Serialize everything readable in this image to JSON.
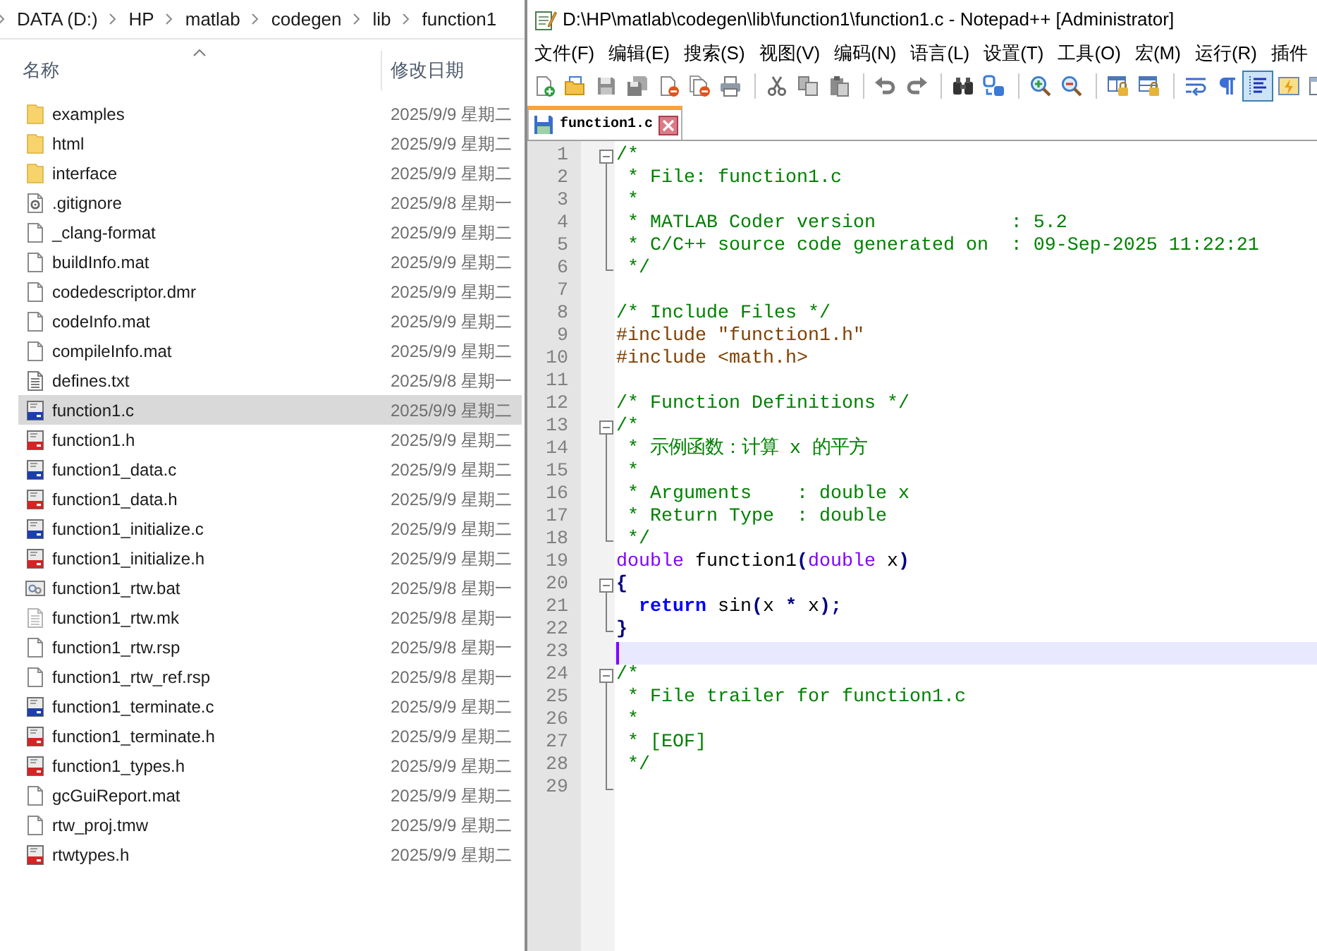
{
  "explorer": {
    "breadcrumb": [
      "DATA (D:)",
      "HP",
      "matlab",
      "codegen",
      "lib",
      "function1"
    ],
    "columns": [
      {
        "label": "名称",
        "sorted": true
      },
      {
        "label": "修改日期",
        "sorted": false
      }
    ],
    "rows": [
      {
        "kind": "folder",
        "name": "examples",
        "date": "2025/9/9 星期二",
        "selected": false
      },
      {
        "kind": "folder",
        "name": "html",
        "date": "2025/9/9 星期二",
        "selected": false
      },
      {
        "kind": "folder",
        "name": "interface",
        "date": "2025/9/9 星期二",
        "selected": false
      },
      {
        "kind": "config",
        "name": ".gitignore",
        "date": "2025/9/8 星期一",
        "selected": false
      },
      {
        "kind": "blank",
        "name": "_clang-format",
        "date": "2025/9/9 星期二",
        "selected": false
      },
      {
        "kind": "blank",
        "name": "buildInfo.mat",
        "date": "2025/9/9 星期二",
        "selected": false
      },
      {
        "kind": "blank",
        "name": "codedescriptor.dmr",
        "date": "2025/9/9 星期二",
        "selected": false
      },
      {
        "kind": "blank",
        "name": "codeInfo.mat",
        "date": "2025/9/9 星期二",
        "selected": false
      },
      {
        "kind": "blank",
        "name": "compileInfo.mat",
        "date": "2025/9/9 星期二",
        "selected": false
      },
      {
        "kind": "text",
        "name": "defines.txt",
        "date": "2025/9/8 星期一",
        "selected": false
      },
      {
        "kind": "source",
        "name": "function1.c",
        "date": "2025/9/9 星期二",
        "selected": true
      },
      {
        "kind": "header",
        "name": "function1.h",
        "date": "2025/9/9 星期二",
        "selected": false
      },
      {
        "kind": "source",
        "name": "function1_data.c",
        "date": "2025/9/9 星期二",
        "selected": false
      },
      {
        "kind": "header",
        "name": "function1_data.h",
        "date": "2025/9/9 星期二",
        "selected": false
      },
      {
        "kind": "source",
        "name": "function1_initialize.c",
        "date": "2025/9/9 星期二",
        "selected": false
      },
      {
        "kind": "header",
        "name": "function1_initialize.h",
        "date": "2025/9/9 星期二",
        "selected": false
      },
      {
        "kind": "batch",
        "name": "function1_rtw.bat",
        "date": "2025/9/8 星期一",
        "selected": false
      },
      {
        "kind": "makefile",
        "name": "function1_rtw.mk",
        "date": "2025/9/8 星期一",
        "selected": false
      },
      {
        "kind": "blank",
        "name": "function1_rtw.rsp",
        "date": "2025/9/8 星期一",
        "selected": false
      },
      {
        "kind": "blank",
        "name": "function1_rtw_ref.rsp",
        "date": "2025/9/8 星期一",
        "selected": false
      },
      {
        "kind": "source",
        "name": "function1_terminate.c",
        "date": "2025/9/9 星期二",
        "selected": false
      },
      {
        "kind": "header",
        "name": "function1_terminate.h",
        "date": "2025/9/9 星期二",
        "selected": false
      },
      {
        "kind": "header",
        "name": "function1_types.h",
        "date": "2025/9/9 星期二",
        "selected": false
      },
      {
        "kind": "blank",
        "name": "gcGuiReport.mat",
        "date": "2025/9/9 星期二",
        "selected": false
      },
      {
        "kind": "blank",
        "name": "rtw_proj.tmw",
        "date": "2025/9/9 星期二",
        "selected": false
      },
      {
        "kind": "header",
        "name": "rtwtypes.h",
        "date": "2025/9/9 星期二",
        "selected": false
      }
    ]
  },
  "editor_window": {
    "title": "D:\\HP\\matlab\\codegen\\lib\\function1\\function1.c - Notepad++ [Administrator]",
    "menu": [
      "文件(F)",
      "编辑(E)",
      "搜索(S)",
      "视图(V)",
      "编码(N)",
      "语言(L)",
      "设置(T)",
      "工具(O)",
      "宏(M)",
      "运行(R)",
      "插件"
    ],
    "toolbar": {
      "groups": [
        {
          "buttons": [
            {
              "pressed": false
            },
            {
              "pressed": false
            },
            {
              "pressed": false
            },
            {
              "pressed": false
            },
            {
              "pressed": false
            },
            {
              "pressed": false
            },
            {
              "pressed": false
            }
          ]
        },
        {
          "buttons": [
            {
              "pressed": false
            },
            {
              "pressed": false
            },
            {
              "pressed": false
            }
          ]
        },
        {
          "buttons": [
            {
              "pressed": false
            },
            {
              "pressed": false
            }
          ]
        },
        {
          "buttons": [
            {
              "pressed": false
            },
            {
              "pressed": false
            }
          ]
        },
        {
          "buttons": [
            {
              "pressed": false
            },
            {
              "pressed": false
            }
          ]
        },
        {
          "buttons": [
            {
              "pressed": false
            },
            {
              "pressed": false
            }
          ]
        },
        {
          "buttons": [
            {
              "pressed": false
            },
            {
              "pressed": false
            },
            {
              "pressed": true
            },
            {
              "pressed": false
            },
            {
              "pressed": false
            }
          ]
        }
      ]
    },
    "tabs": [
      {
        "label": "function1.c",
        "selected": true,
        "modified": false
      }
    ],
    "lines": [
      {
        "number": "1",
        "kind": "head",
        "current": false,
        "tokens": [
          {
            "kind": "comment",
            "text": "/*"
          }
        ]
      },
      {
        "number": "2",
        "kind": "body",
        "current": false,
        "tokens": [
          {
            "kind": "comment",
            "text": " * File: function1.c"
          }
        ]
      },
      {
        "number": "3",
        "kind": "body",
        "current": false,
        "tokens": [
          {
            "kind": "comment",
            "text": " *"
          }
        ]
      },
      {
        "number": "4",
        "kind": "body",
        "current": false,
        "tokens": [
          {
            "kind": "comment",
            "text": " * MATLAB Coder version            : 5.2"
          }
        ]
      },
      {
        "number": "5",
        "kind": "body",
        "current": false,
        "tokens": [
          {
            "kind": "comment",
            "text": " * C/C++ source code generated on  : 09-Sep-2025 11:22:21"
          }
        ]
      },
      {
        "number": "6",
        "kind": "tail",
        "current": false,
        "tokens": [
          {
            "kind": "comment",
            "text": " */"
          }
        ]
      },
      {
        "number": "7",
        "kind": "plain",
        "current": false
      },
      {
        "number": "8",
        "kind": "plain",
        "current": false,
        "tokens": [
          {
            "kind": "comment",
            "text": "/* Include Files */"
          }
        ]
      },
      {
        "number": "9",
        "kind": "plain",
        "current": false,
        "tokens": [
          {
            "kind": "preprocessor",
            "text": "#include \"function1.h\""
          }
        ]
      },
      {
        "number": "10",
        "kind": "plain",
        "current": false,
        "tokens": [
          {
            "kind": "preprocessor",
            "text": "#include <math.h>"
          }
        ]
      },
      {
        "number": "11",
        "kind": "plain",
        "current": false
      },
      {
        "number": "12",
        "kind": "plain",
        "current": false,
        "tokens": [
          {
            "kind": "comment",
            "text": "/* Function Definitions */"
          }
        ]
      },
      {
        "number": "13",
        "kind": "head",
        "current": false,
        "tokens": [
          {
            "kind": "comment",
            "text": "/*"
          }
        ]
      },
      {
        "number": "14",
        "kind": "body",
        "current": false,
        "tokens": [
          {
            "kind": "comment",
            "text": " * 示例函数：计算 x 的平方"
          }
        ]
      },
      {
        "number": "15",
        "kind": "body",
        "current": false,
        "tokens": [
          {
            "kind": "comment",
            "text": " *"
          }
        ]
      },
      {
        "number": "16",
        "kind": "body",
        "current": false,
        "tokens": [
          {
            "kind": "comment",
            "text": " * Arguments    : double x"
          }
        ]
      },
      {
        "number": "17",
        "kind": "body",
        "current": false,
        "tokens": [
          {
            "kind": "comment",
            "text": " * Return Type  : double"
          }
        ]
      },
      {
        "number": "18",
        "kind": "tail",
        "current": false,
        "tokens": [
          {
            "kind": "comment",
            "text": " */"
          }
        ]
      },
      {
        "number": "19",
        "kind": "plain",
        "current": false,
        "tokens": [
          {
            "kind": "type",
            "text": "double"
          },
          {
            "kind": "plain",
            "text": " function1"
          },
          {
            "kind": "operator",
            "text": "("
          },
          {
            "kind": "type",
            "text": "double"
          },
          {
            "kind": "plain",
            "text": " x"
          },
          {
            "kind": "operator",
            "text": ")"
          }
        ]
      },
      {
        "number": "20",
        "kind": "head",
        "current": false,
        "tokens": [
          {
            "kind": "operator",
            "text": "{"
          }
        ]
      },
      {
        "number": "21",
        "kind": "body",
        "current": false,
        "tokens": [
          {
            "kind": "keyword",
            "text": "  return"
          },
          {
            "kind": "plain",
            "text": " sin"
          },
          {
            "kind": "operator",
            "text": "("
          },
          {
            "kind": "plain",
            "text": "x "
          },
          {
            "kind": "operator",
            "text": "*"
          },
          {
            "kind": "plain",
            "text": " x"
          },
          {
            "kind": "operator",
            "text": ");"
          }
        ]
      },
      {
        "number": "22",
        "kind": "tail",
        "current": false,
        "tokens": [
          {
            "kind": "operator",
            "text": "}"
          }
        ]
      },
      {
        "number": "23",
        "kind": "plain",
        "current": true
      },
      {
        "number": "24",
        "kind": "head",
        "current": false,
        "tokens": [
          {
            "kind": "comment",
            "text": "/*"
          }
        ]
      },
      {
        "number": "25",
        "kind": "body",
        "current": false,
        "tokens": [
          {
            "kind": "comment",
            "text": " * File trailer for function1.c"
          }
        ]
      },
      {
        "number": "26",
        "kind": "body",
        "current": false,
        "tokens": [
          {
            "kind": "comment",
            "text": " *"
          }
        ]
      },
      {
        "number": "27",
        "kind": "body",
        "current": false,
        "tokens": [
          {
            "kind": "comment",
            "text": " * [EOF]"
          }
        ]
      },
      {
        "number": "28",
        "kind": "body",
        "current": false,
        "tokens": [
          {
            "kind": "comment",
            "text": " */"
          }
        ]
      },
      {
        "number": "29",
        "kind": "tail",
        "current": false
      }
    ]
  }
}
